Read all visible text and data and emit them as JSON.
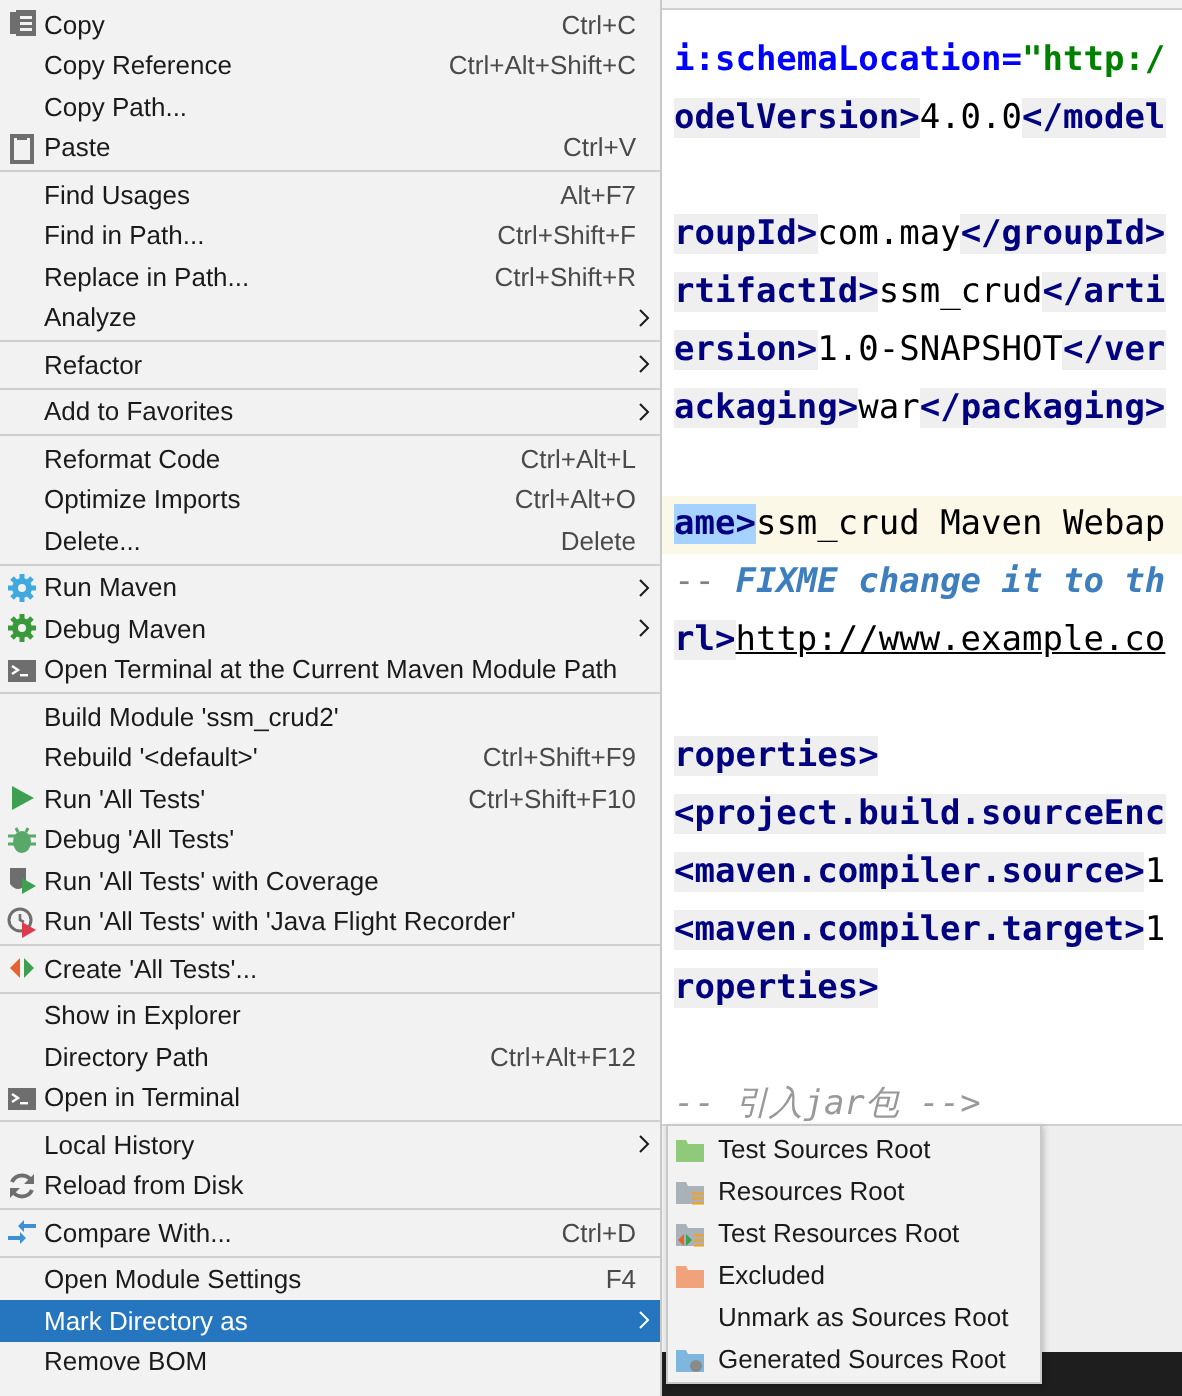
{
  "context_menu": {
    "groups": [
      [
        {
          "label": "Copy",
          "shortcut": "Ctrl+C",
          "kind": "copy",
          "submenu": false,
          "selected": false
        },
        {
          "label": "Copy Reference",
          "shortcut": "Ctrl+Alt+Shift+C",
          "kind": "plain",
          "submenu": false,
          "selected": false
        },
        {
          "label": "Copy Path...",
          "kind": "plain",
          "submenu": false,
          "selected": false
        },
        {
          "label": "Paste",
          "shortcut": "Ctrl+V",
          "kind": "paste",
          "submenu": false,
          "selected": false
        }
      ],
      [
        {
          "label": "Find Usages",
          "shortcut": "Alt+F7",
          "kind": "plain",
          "submenu": false,
          "selected": false
        },
        {
          "label": "Find in Path...",
          "shortcut": "Ctrl+Shift+F",
          "kind": "plain",
          "submenu": false,
          "selected": false
        },
        {
          "label": "Replace in Path...",
          "shortcut": "Ctrl+Shift+R",
          "kind": "plain",
          "submenu": false,
          "selected": false
        },
        {
          "label": "Analyze",
          "kind": "plain",
          "submenu": true,
          "selected": false
        }
      ],
      [
        {
          "label": "Refactor",
          "kind": "plain",
          "submenu": true,
          "selected": false
        }
      ],
      [
        {
          "label": "Add to Favorites",
          "kind": "plain",
          "submenu": true,
          "selected": false
        }
      ],
      [
        {
          "label": "Reformat Code",
          "shortcut": "Ctrl+Alt+L",
          "kind": "plain",
          "submenu": false,
          "selected": false
        },
        {
          "label": "Optimize Imports",
          "shortcut": "Ctrl+Alt+O",
          "kind": "plain",
          "submenu": false,
          "selected": false
        },
        {
          "label": "Delete...",
          "shortcut": "Delete",
          "kind": "plain",
          "submenu": false,
          "selected": false
        }
      ],
      [
        {
          "label": "Run Maven",
          "kind": "maven-run",
          "submenu": true,
          "selected": false
        },
        {
          "label": "Debug Maven",
          "kind": "maven-debug",
          "submenu": true,
          "selected": false
        },
        {
          "label": "Open Terminal at the Current Maven Module Path",
          "kind": "terminal",
          "submenu": false,
          "selected": false
        }
      ],
      [
        {
          "label": "Build Module 'ssm_crud2'",
          "kind": "plain",
          "submenu": false,
          "selected": false
        },
        {
          "label": "Rebuild '<default>'",
          "shortcut": "Ctrl+Shift+F9",
          "kind": "plain",
          "submenu": false,
          "selected": false
        },
        {
          "label": "Run 'All Tests'",
          "shortcut": "Ctrl+Shift+F10",
          "kind": "run",
          "submenu": false,
          "selected": false
        },
        {
          "label": "Debug 'All Tests'",
          "kind": "debug",
          "submenu": false,
          "selected": false
        },
        {
          "label": "Run 'All Tests' with Coverage",
          "kind": "coverage",
          "submenu": false,
          "selected": false
        },
        {
          "label": "Run 'All Tests' with 'Java Flight Recorder'",
          "kind": "profiler",
          "submenu": false,
          "selected": false
        }
      ],
      [
        {
          "label": "Create 'All Tests'...",
          "kind": "create-test",
          "submenu": false,
          "selected": false
        }
      ],
      [
        {
          "label": "Show in Explorer",
          "kind": "plain",
          "submenu": false,
          "selected": false
        },
        {
          "label": "Directory Path",
          "shortcut": "Ctrl+Alt+F12",
          "kind": "plain",
          "submenu": false,
          "selected": false
        },
        {
          "label": "Open in Terminal",
          "kind": "terminal",
          "submenu": false,
          "selected": false
        }
      ],
      [
        {
          "label": "Local History",
          "kind": "plain",
          "submenu": true,
          "selected": false
        },
        {
          "label": "Reload from Disk",
          "kind": "reload",
          "submenu": false,
          "selected": false
        }
      ],
      [
        {
          "label": "Compare With...",
          "shortcut": "Ctrl+D",
          "kind": "compare",
          "submenu": false,
          "selected": false
        }
      ],
      [
        {
          "label": "Open Module Settings",
          "shortcut": "F4",
          "kind": "plain",
          "submenu": false,
          "selected": false
        },
        {
          "label": "Mark Directory as",
          "kind": "plain",
          "submenu": true,
          "selected": true
        },
        {
          "label": "Remove BOM",
          "kind": "plain",
          "submenu": false,
          "selected": false
        }
      ]
    ]
  },
  "submenu": {
    "items": [
      {
        "label": "Test Sources Root",
        "kind": "test-sources"
      },
      {
        "label": "Resources Root",
        "kind": "resources"
      },
      {
        "label": "Test Resources Root",
        "kind": "test-resources"
      },
      {
        "label": "Excluded",
        "kind": "excluded"
      },
      {
        "label": "Unmark as Sources Root",
        "kind": "plain"
      },
      {
        "label": "Generated Sources Root",
        "kind": "generated"
      }
    ]
  },
  "editor": {
    "lines": [
      {
        "current": false,
        "segments": [
          {
            "kind": "attr",
            "text": "i:schemaLocation="
          },
          {
            "kind": "string",
            "text": "\"http:/"
          }
        ]
      },
      {
        "current": false,
        "segments": [
          {
            "kind": "tag",
            "text": "odelVersion>"
          },
          {
            "kind": "text",
            "text": "4.0.0"
          },
          {
            "kind": "tag",
            "text": "</model"
          }
        ]
      },
      {
        "current": false
      },
      {
        "current": false,
        "segments": [
          {
            "kind": "tag",
            "text": "roupId>"
          },
          {
            "kind": "text",
            "text": "com.may"
          },
          {
            "kind": "tag",
            "text": "</groupId>"
          }
        ]
      },
      {
        "current": false,
        "segments": [
          {
            "kind": "tag",
            "text": "rtifactId>"
          },
          {
            "kind": "text",
            "text": "ssm_crud"
          },
          {
            "kind": "tag",
            "text": "</arti"
          }
        ]
      },
      {
        "current": false,
        "segments": [
          {
            "kind": "tag",
            "text": "ersion>"
          },
          {
            "kind": "text",
            "text": "1.0-SNAPSHOT"
          },
          {
            "kind": "tag",
            "text": "</ver"
          }
        ]
      },
      {
        "current": false,
        "segments": [
          {
            "kind": "tag",
            "text": "ackaging>"
          },
          {
            "kind": "text",
            "text": "war"
          },
          {
            "kind": "tag",
            "text": "</packaging>"
          }
        ]
      },
      {
        "current": false
      },
      {
        "current": true,
        "segments": [
          {
            "kind": "match",
            "text": "ame>"
          },
          {
            "kind": "text",
            "text": "ssm_crud Maven Webap"
          }
        ]
      },
      {
        "current": false,
        "segments": [
          {
            "kind": "comment-mark",
            "text": "--"
          },
          {
            "kind": "comment",
            "text": " FIXME change it to th"
          }
        ]
      },
      {
        "current": false,
        "segments": [
          {
            "kind": "tag",
            "text": "rl>"
          },
          {
            "kind": "link",
            "text": "http://www.example.co"
          }
        ]
      },
      {
        "current": false
      },
      {
        "current": false,
        "segments": [
          {
            "kind": "tag",
            "text": "roperties>"
          }
        ]
      },
      {
        "current": false,
        "segments": [
          {
            "kind": "tag",
            "text": "<project.build.sourceEnc"
          }
        ]
      },
      {
        "current": false,
        "segments": [
          {
            "kind": "tag",
            "text": "<maven.compiler.source>"
          },
          {
            "kind": "text",
            "text": "1"
          }
        ]
      },
      {
        "current": false,
        "segments": [
          {
            "kind": "tag",
            "text": "<maven.compiler.target>"
          },
          {
            "kind": "text",
            "text": "1"
          }
        ]
      },
      {
        "current": false,
        "segments": [
          {
            "kind": "tag",
            "text": "roperties>"
          }
        ]
      },
      {
        "current": false
      },
      {
        "current": false,
        "segments": [
          {
            "kind": "gray-comment",
            "text": "-- 引入jar包 -->"
          }
        ]
      }
    ]
  }
}
